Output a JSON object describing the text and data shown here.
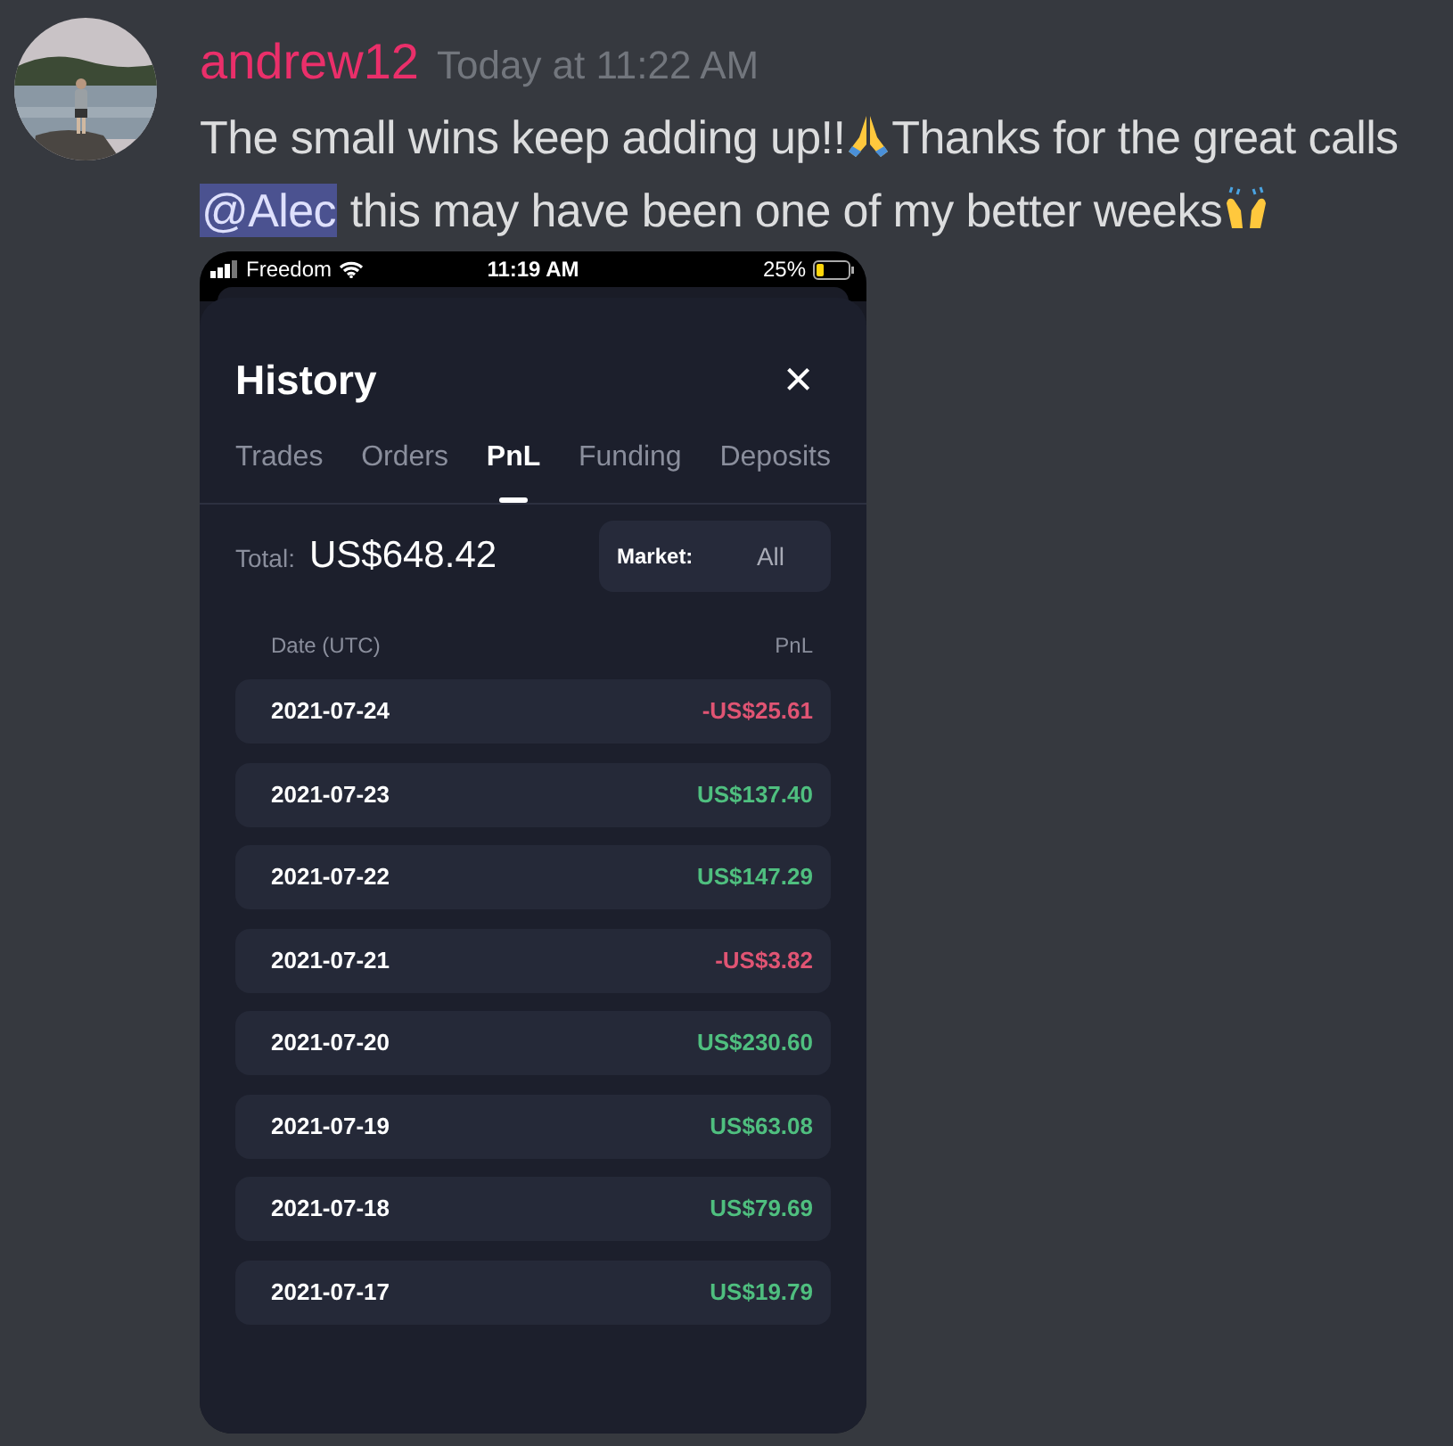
{
  "message": {
    "author": "andrew12",
    "timestamp": "Today at 11:22 AM",
    "parts": [
      {
        "kind": "text",
        "text": "The small wins keep adding up!!"
      },
      {
        "kind": "folded"
      },
      {
        "kind": "text",
        "text": "Thanks for the great calls "
      },
      {
        "kind": "mention",
        "text": "@Alec"
      },
      {
        "kind": "text",
        "text": " this may have been one of my better weeks"
      },
      {
        "kind": "raised"
      }
    ]
  },
  "phone": {
    "status_bar": {
      "carrier": "Freedom",
      "time": "11:19 AM",
      "battery": "25%"
    },
    "modal": {
      "title": "History",
      "close": "×",
      "tabs": [
        {
          "label": "Trades",
          "selected": false
        },
        {
          "label": "Orders",
          "selected": false
        },
        {
          "label": "PnL",
          "selected": true
        },
        {
          "label": "Funding",
          "selected": false
        },
        {
          "label": "Deposits",
          "selected": false
        }
      ],
      "total_label": "Total:",
      "total_value": "US$648.42",
      "market_label": "Market:",
      "market_value": "All",
      "columns": [
        "Date (UTC)",
        "PnL"
      ],
      "rows": [
        {
          "date": "2021-07-24",
          "pnl": "-US$25.61",
          "color": "#e05473"
        },
        {
          "date": "2021-07-23",
          "pnl": "US$137.40",
          "color": "#4fbf7f"
        },
        {
          "date": "2021-07-22",
          "pnl": "US$147.29",
          "color": "#4fbf7f"
        },
        {
          "date": "2021-07-21",
          "pnl": "-US$3.82",
          "color": "#e05473"
        },
        {
          "date": "2021-07-20",
          "pnl": "US$230.60",
          "color": "#4fbf7f"
        },
        {
          "date": "2021-07-19",
          "pnl": "US$63.08",
          "color": "#4fbf7f"
        },
        {
          "date": "2021-07-18",
          "pnl": "US$79.69",
          "color": "#4fbf7f"
        },
        {
          "date": "2021-07-17",
          "pnl": "US$19.79",
          "color": "#4fbf7f"
        }
      ]
    }
  }
}
